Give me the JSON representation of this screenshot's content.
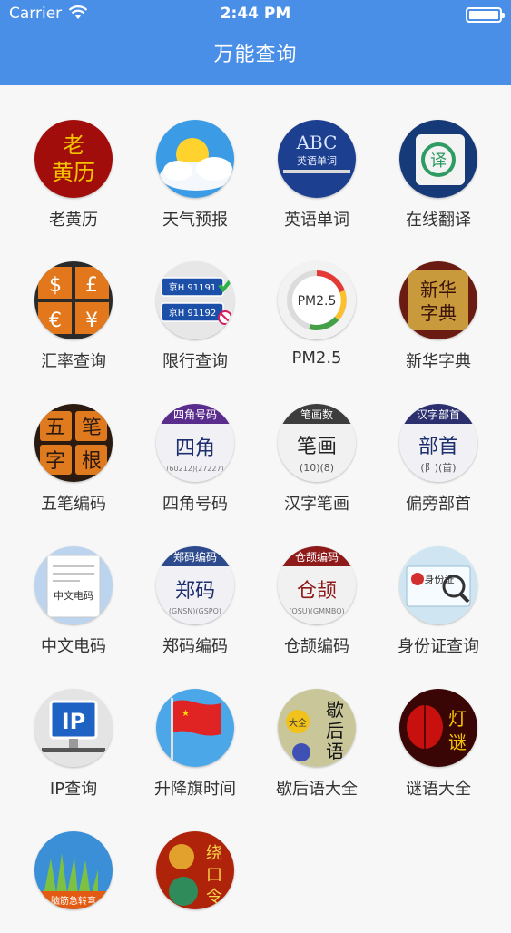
{
  "status_bar": {
    "carrier": "Carrier",
    "time": "2:44 PM"
  },
  "header": {
    "title": "万能查询"
  },
  "items": [
    {
      "label": "老黄历",
      "icon": "almanac-icon",
      "glyph": "老黄历"
    },
    {
      "label": "天气预报",
      "icon": "weather-icon"
    },
    {
      "label": "英语单词",
      "icon": "english-words-icon",
      "glyph": "ABC",
      "sub": "英语单词"
    },
    {
      "label": "在线翻译",
      "icon": "translate-icon",
      "glyph": "译"
    },
    {
      "label": "汇率查询",
      "icon": "exchange-rate-icon",
      "glyph": "$£€¥"
    },
    {
      "label": "限行查询",
      "icon": "traffic-restriction-icon",
      "plate1": "京H 91191",
      "plate2": "京H 91192"
    },
    {
      "label": "PM2.5",
      "icon": "pm25-icon",
      "glyph": "PM2.5"
    },
    {
      "label": "新华字典",
      "icon": "dictionary-icon",
      "glyph": "新华字典"
    },
    {
      "label": "五笔编码",
      "icon": "wubi-icon",
      "glyph": "五笔字根"
    },
    {
      "label": "四角号码",
      "icon": "four-corner-icon",
      "head": "四角号码",
      "glyph": "四角"
    },
    {
      "label": "汉字笔画",
      "icon": "strokes-icon",
      "head": "笔画数",
      "glyph": "笔画",
      "sub": "(10)(8)"
    },
    {
      "label": "偏旁部首",
      "icon": "radicals-icon",
      "head": "汉字部首",
      "glyph": "部首",
      "sub": "(阝)(首)"
    },
    {
      "label": "中文电码",
      "icon": "telegraph-code-icon",
      "glyph": "中文电码"
    },
    {
      "label": "郑码编码",
      "icon": "zhengma-icon",
      "head": "郑码编码",
      "glyph": "郑码"
    },
    {
      "label": "仓颉编码",
      "icon": "cangjie-icon",
      "head": "仓颉编码",
      "glyph": "仓颉"
    },
    {
      "label": "身份证查询",
      "icon": "id-card-icon",
      "glyph": "身份证"
    },
    {
      "label": "IP查询",
      "icon": "ip-lookup-icon",
      "glyph": "IP"
    },
    {
      "label": "升降旗时间",
      "icon": "flag-time-icon"
    },
    {
      "label": "歇后语大全",
      "icon": "xiehouyu-icon",
      "glyph": "歇后语",
      "sub": "大全"
    },
    {
      "label": "谜语大全",
      "icon": "riddles-icon",
      "glyph": "灯谜"
    },
    {
      "label": "",
      "icon": "brain-teaser-icon",
      "glyph": "脑筋急转弯"
    },
    {
      "label": "",
      "icon": "tongue-twister-icon",
      "glyph": "绕口令"
    }
  ]
}
